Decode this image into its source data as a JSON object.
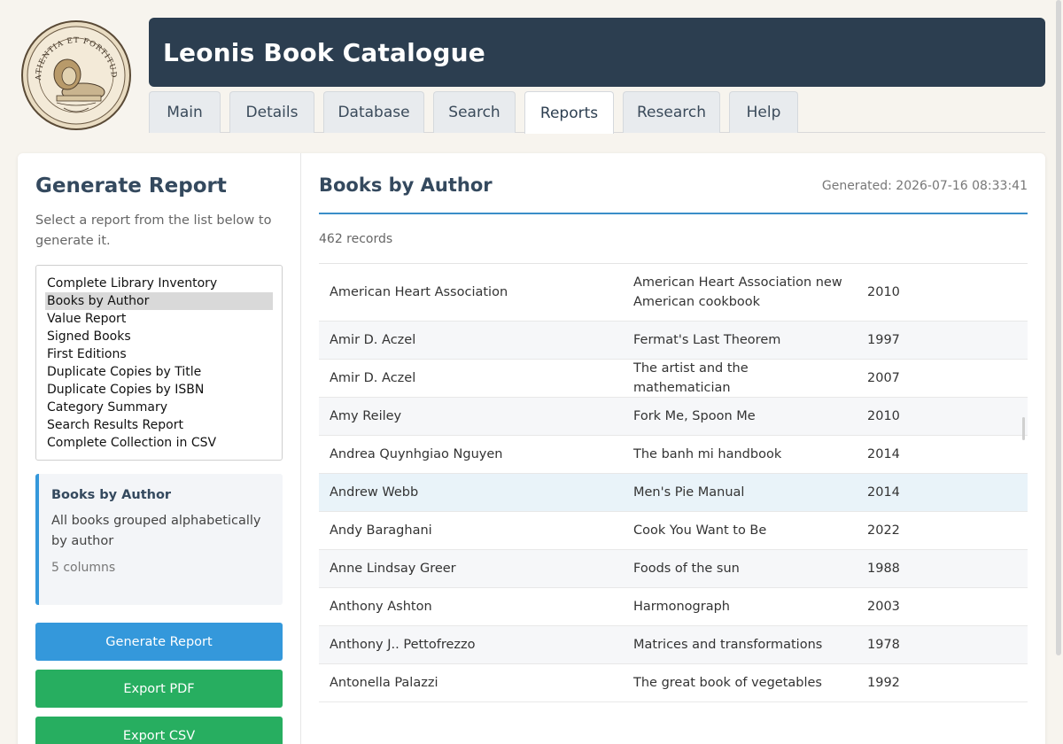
{
  "app": {
    "title": "Leonis Book Catalogue",
    "seal_text": "PATIENTIA ET FORTITUDO"
  },
  "tabs": [
    {
      "label": "Main",
      "active": false
    },
    {
      "label": "Details",
      "active": false
    },
    {
      "label": "Database",
      "active": false
    },
    {
      "label": "Search",
      "active": false
    },
    {
      "label": "Reports",
      "active": true
    },
    {
      "label": "Research",
      "active": false
    },
    {
      "label": "Help",
      "active": false
    }
  ],
  "sidebar": {
    "heading": "Generate Report",
    "hint": "Select a report from the list below to generate it.",
    "reports": [
      "Complete Library Inventory",
      "Books by Author",
      "Value Report",
      "Signed Books",
      "First Editions",
      "Duplicate Copies by Title",
      "Duplicate Copies by ISBN",
      "Category Summary",
      "Search Results Report",
      "Complete Collection in CSV"
    ],
    "selected_report": "Books by Author",
    "info": {
      "title": "Books by Author",
      "description": "All books grouped alphabetically by author",
      "columns": "5 columns"
    },
    "buttons": {
      "generate": "Generate Report",
      "export_pdf": "Export PDF",
      "export_csv": "Export CSV"
    }
  },
  "report": {
    "title": "Books by Author",
    "generated": "Generated: 2026-07-16 08:33:41",
    "records": "462 records",
    "rows": [
      {
        "author": "American Heart Association",
        "title": "American Heart Association new American cookbook",
        "year": "2010"
      },
      {
        "author": "Amir D. Aczel",
        "title": "Fermat's Last Theorem",
        "year": "1997"
      },
      {
        "author": "Amir D. Aczel",
        "title": "The artist and the mathematician",
        "year": "2007"
      },
      {
        "author": "Amy Reiley",
        "title": "Fork Me, Spoon Me",
        "year": "2010"
      },
      {
        "author": "Andrea Quynhgiao Nguyen",
        "title": "The banh mi handbook",
        "year": "2014"
      },
      {
        "author": "Andrew Webb",
        "title": "Men's Pie Manual",
        "year": "2014"
      },
      {
        "author": "Andy Baraghani",
        "title": "Cook You Want to Be",
        "year": "2022"
      },
      {
        "author": "Anne Lindsay Greer",
        "title": "Foods of the sun",
        "year": "1988"
      },
      {
        "author": "Anthony Ashton",
        "title": "Harmonograph",
        "year": "2003"
      },
      {
        "author": "Anthony J.. Pettofrezzo",
        "title": "Matrices and transformations",
        "year": "1978"
      },
      {
        "author": "Antonella Palazzi",
        "title": "The great book of vegetables",
        "year": "1992"
      }
    ]
  },
  "colors": {
    "header_bg": "#2c3e50",
    "accent_blue": "#3498db",
    "accent_green": "#27ae60",
    "page_bg": "#f7f4ee"
  }
}
